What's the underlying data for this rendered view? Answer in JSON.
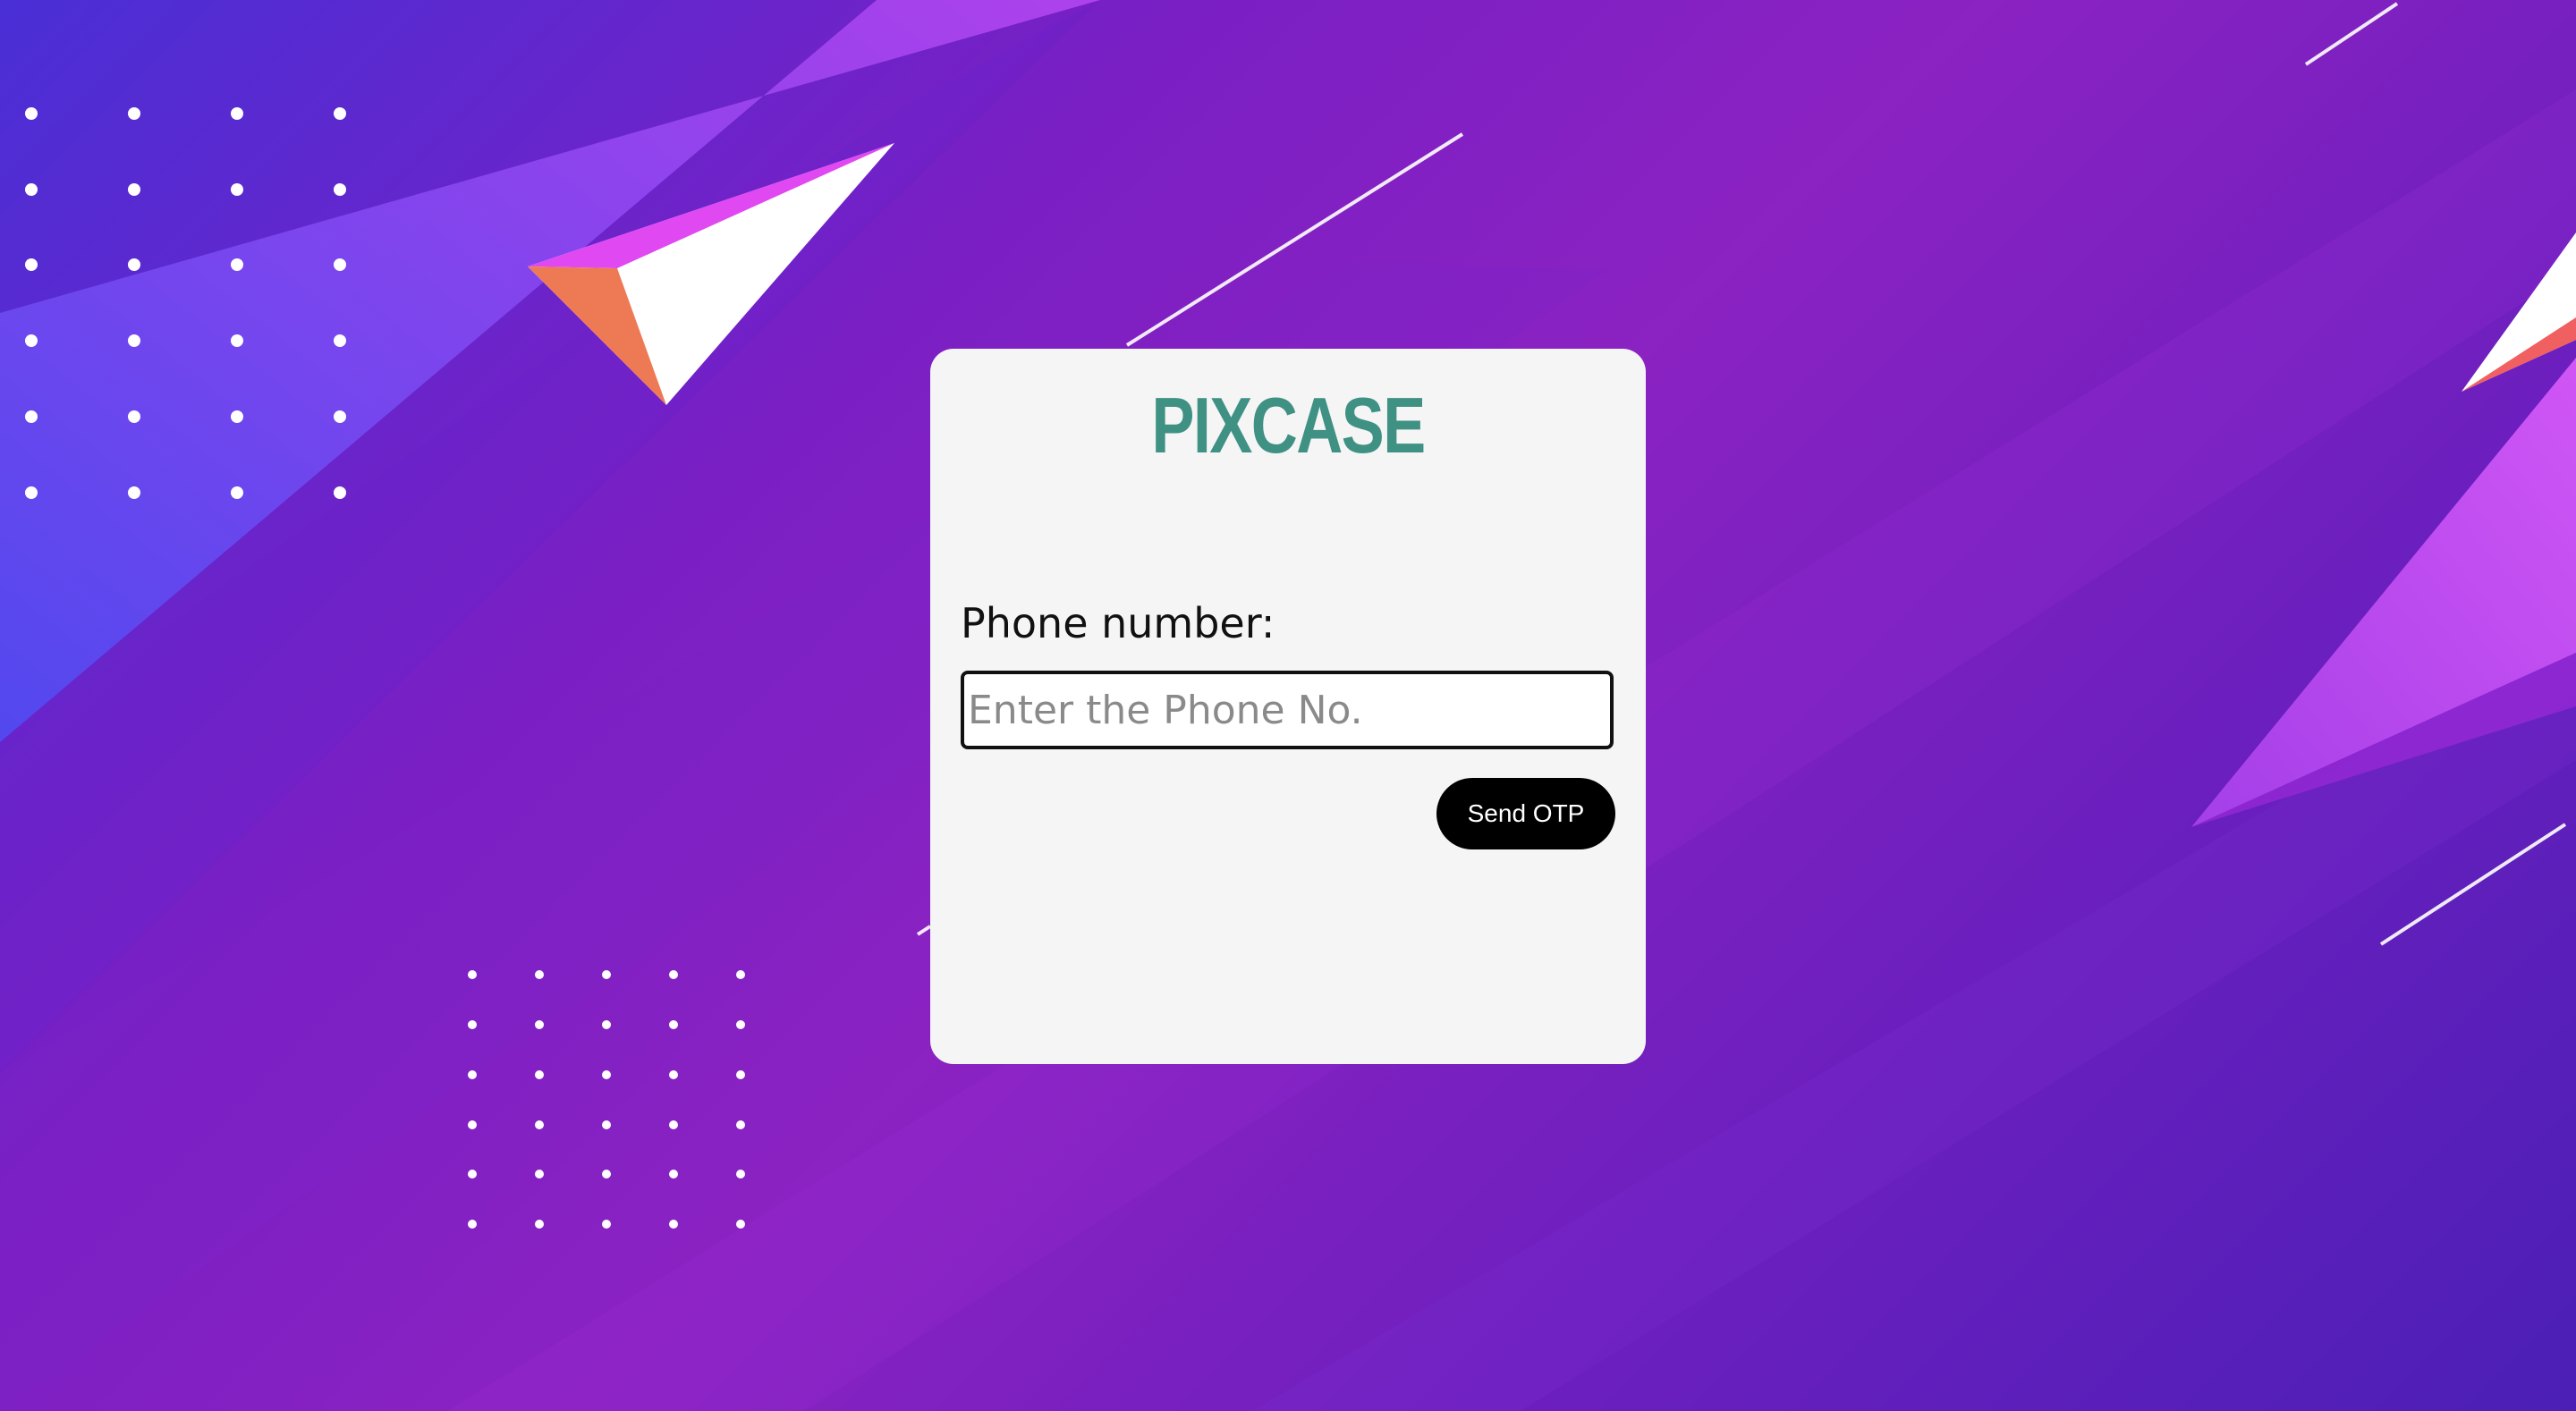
{
  "brand": {
    "name": "PIXCASE",
    "color": "#3f9183"
  },
  "form": {
    "phone_label": "Phone number:",
    "phone_placeholder": "Enter the Phone No.",
    "phone_value": "",
    "submit_label": "Send OTP"
  },
  "theme": {
    "background_primary": "#7a1fc4",
    "card_background": "#f5f5f5",
    "button_background": "#000000",
    "button_text": "#ffffff"
  }
}
